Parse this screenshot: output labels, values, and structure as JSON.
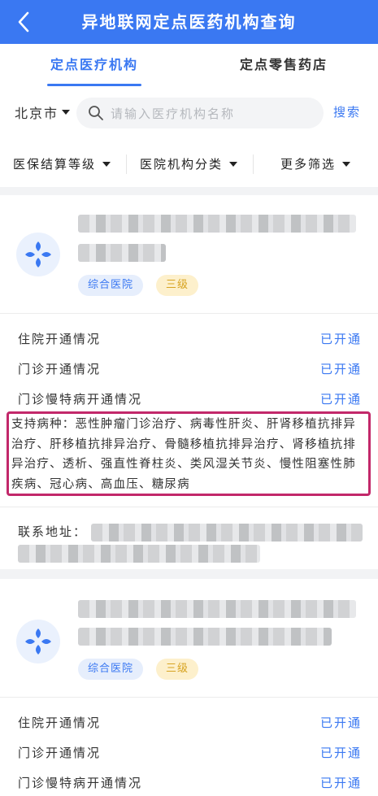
{
  "header": {
    "title": "异地联网定点医药机构查询"
  },
  "tabs": [
    {
      "label": "定点医疗机构",
      "active": true
    },
    {
      "label": "定点零售药店",
      "active": false
    }
  ],
  "search": {
    "city": "北京市",
    "placeholder": "请输入医疗机构名称",
    "value": "",
    "button": "搜索"
  },
  "filters": [
    {
      "label": "医保结算等级"
    },
    {
      "label": "医院机构分类"
    },
    {
      "label": "更多筛选"
    }
  ],
  "colors": {
    "primary": "#3a78f2",
    "highlight": "#c2286a",
    "tag_blue_bg": "#e6eefc",
    "tag_yellow_bg": "#fdf0cc"
  },
  "cards": [
    {
      "type_tag": "综合医院",
      "level_tag": "三级",
      "rows": [
        {
          "label": "住院开通情况",
          "value": "已开通"
        },
        {
          "label": "门诊开通情况",
          "value": "已开通"
        },
        {
          "label": "门诊慢特病开通情况",
          "value": "已开通"
        }
      ],
      "diseases": "支持病种：恶性肿瘤门诊治疗、病毒性肝炎、肝肾移植抗排异治疗、肝移植抗排异治疗、骨髓移植抗排异治疗、肾移植抗排异治疗、透析、强直性脊柱炎、类风湿关节炎、慢性阻塞性肺疾病、冠心病、高血压、糖尿病",
      "address_label": "联系地址："
    },
    {
      "type_tag": "综合医院",
      "level_tag": "三级",
      "rows": [
        {
          "label": "住院开通情况",
          "value": "已开通"
        },
        {
          "label": "门诊开通情况",
          "value": "已开通"
        },
        {
          "label": "门诊慢特病开通情况",
          "value": "已开通"
        }
      ]
    }
  ]
}
